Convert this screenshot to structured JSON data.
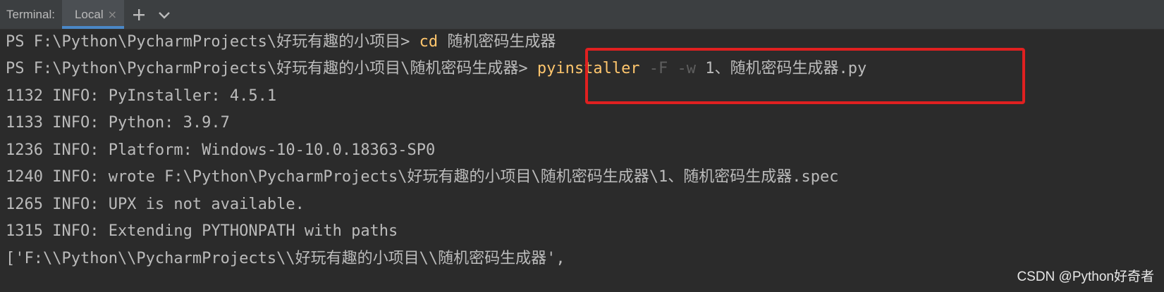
{
  "tabbar": {
    "title": "Terminal:",
    "active_tab": "Local",
    "close_glyph": "×",
    "icons": [
      "plus-icon",
      "chevron-down-icon"
    ]
  },
  "terminal": {
    "lines": [
      {
        "prompt": "PS F:\\Python\\PycharmProjects\\好玩有趣的小项目> ",
        "cmd": "cd",
        "args": " 随机密码生成器"
      },
      {
        "prompt": "PS F:\\Python\\PycharmProjects\\好玩有趣的小项目\\随机密码生成器> ",
        "cmd": "pyinstaller",
        "flags": " -F -w",
        "args": " 1、随机密码生成器.py"
      },
      {
        "text": "1132 INFO: PyInstaller: 4.5.1"
      },
      {
        "text": "1133 INFO: Python: 3.9.7"
      },
      {
        "text": "1236 INFO: Platform: Windows-10-10.0.18363-SP0"
      },
      {
        "text": "1240 INFO: wrote F:\\Python\\PycharmProjects\\好玩有趣的小项目\\随机密码生成器\\1、随机密码生成器.spec"
      },
      {
        "text": "1265 INFO: UPX is not available."
      },
      {
        "text": "1315 INFO: Extending PYTHONPATH with paths"
      },
      {
        "text": "['F:\\\\Python\\\\PycharmProjects\\\\好玩有趣的小项目\\\\随机密码生成器',"
      }
    ]
  },
  "watermark": "CSDN @Python好奇者",
  "colors": {
    "background": "#2b2b2b",
    "tabbar": "#3c3f41",
    "active_tab_underline": "#4a88c7",
    "command": "#ffc66d",
    "highlight_box": "#e02020"
  }
}
